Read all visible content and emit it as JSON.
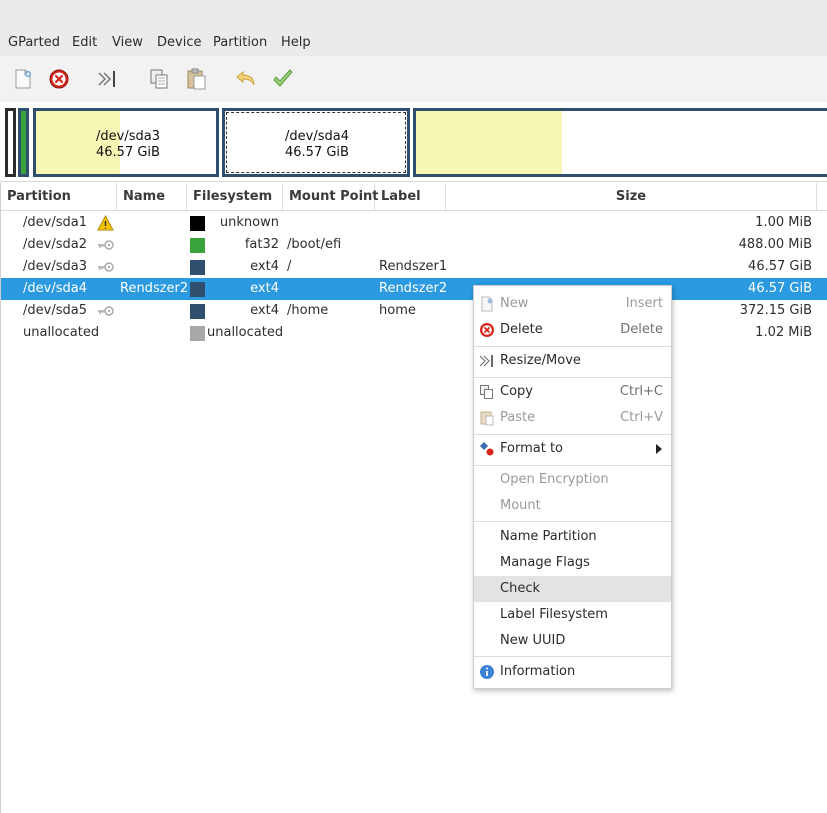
{
  "menubar": {
    "items": [
      "GParted",
      "Edit",
      "View",
      "Device",
      "Partition",
      "Help"
    ]
  },
  "toolbar": {
    "buttons": [
      "new-icon",
      "delete-icon",
      "resize-move-icon",
      "copy-icon",
      "paste-icon",
      "undo-icon",
      "apply-icon"
    ]
  },
  "diskmap": {
    "sda3": {
      "name": "/dev/sda3",
      "size": "46.57 GiB"
    },
    "sda4": {
      "name": "/dev/sda4",
      "size": "46.57 GiB"
    }
  },
  "table": {
    "headers": [
      "Partition",
      "Name",
      "Filesystem",
      "Mount Point",
      "Label",
      "Size"
    ],
    "rows": [
      {
        "partition": "/dev/sda1",
        "name": "",
        "filesystem": "unknown",
        "mount": "",
        "label": "",
        "size": "1.00 MiB",
        "color": "#000000",
        "status": "warning-icon"
      },
      {
        "partition": "/dev/sda2",
        "name": "",
        "filesystem": "fat32",
        "mount": "/boot/efi",
        "label": "",
        "size": "488.00 MiB",
        "color": "#3aa23a",
        "status": "key-icon"
      },
      {
        "partition": "/dev/sda3",
        "name": "",
        "filesystem": "ext4",
        "mount": "/",
        "label": "Rendszer1",
        "size": "46.57 GiB",
        "color": "#2f4f6f",
        "status": "key-icon"
      },
      {
        "partition": "/dev/sda4",
        "name": "Rendszer2",
        "filesystem": "ext4",
        "mount": "",
        "label": "Rendszer2",
        "size": "46.57 GiB",
        "color": "#2f4f6f",
        "status": ""
      },
      {
        "partition": "/dev/sda5",
        "name": "",
        "filesystem": "ext4",
        "mount": "/home",
        "label": "home",
        "size": "372.15 GiB",
        "color": "#2f4f6f",
        "status": "key-icon"
      },
      {
        "partition": "unallocated",
        "name": "",
        "filesystem": "unallocated",
        "mount": "",
        "label": "",
        "size": "1.02 MiB",
        "color": "#a8a8a8",
        "status": ""
      }
    ],
    "selected_row": 3
  },
  "context_menu": {
    "items": [
      {
        "label": "New",
        "accel": "Insert",
        "disabled": true,
        "icon": "new-icon"
      },
      {
        "label": "Delete",
        "accel": "Delete",
        "disabled": false,
        "icon": "delete-icon"
      },
      {
        "label": "Resize/Move",
        "accel": "",
        "disabled": false,
        "icon": "resize-move-icon"
      },
      {
        "label": "Copy",
        "accel": "Ctrl+C",
        "disabled": false,
        "icon": "copy-icon"
      },
      {
        "label": "Paste",
        "accel": "Ctrl+V",
        "disabled": true,
        "icon": "paste-icon"
      },
      {
        "label": "Format to",
        "accel": "",
        "disabled": false,
        "icon": "format-icon",
        "submenu": true
      },
      {
        "label": "Open Encryption",
        "accel": "",
        "disabled": true
      },
      {
        "label": "Mount",
        "accel": "",
        "disabled": true
      },
      {
        "label": "Name Partition",
        "accel": "",
        "disabled": false
      },
      {
        "label": "Manage Flags",
        "accel": "",
        "disabled": false
      },
      {
        "label": "Check",
        "accel": "",
        "disabled": false,
        "hover": true
      },
      {
        "label": "Label Filesystem",
        "accel": "",
        "disabled": false
      },
      {
        "label": "New UUID",
        "accel": "",
        "disabled": false
      },
      {
        "label": "Information",
        "accel": "",
        "disabled": false,
        "icon": "info-icon"
      }
    ]
  },
  "colors": {
    "selection": "#2b9ae0",
    "ext4": "#2f4f6f",
    "fat32": "#3aa23a",
    "used_space": "#f7f7b5"
  }
}
